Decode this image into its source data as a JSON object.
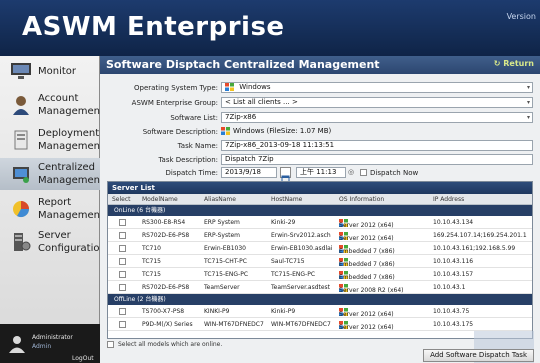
{
  "header": {
    "title": "ASWM Enterprise",
    "version": "Version"
  },
  "sidebar": {
    "items": [
      {
        "label": "Monitor",
        "icon": "monitor-icon"
      },
      {
        "label": "Account Management",
        "icon": "account-icon"
      },
      {
        "label": "Deployment Management",
        "icon": "deployment-icon"
      },
      {
        "label": "Centralized Management",
        "icon": "centralized-icon"
      },
      {
        "label": "Report Management",
        "icon": "report-icon"
      },
      {
        "label": "Server Configuration",
        "icon": "server-icon"
      }
    ],
    "user": {
      "name": "Administrator",
      "role": "Admin",
      "logout": "LogOut"
    }
  },
  "main": {
    "title": "Software Disptach Centralized Management",
    "return_label": "Return",
    "form": {
      "os_type_label": "Operating System Type:",
      "os_type_value": "Windows",
      "group_label": "ASWM Enterprise Group:",
      "group_value": "< List all clients ... >",
      "software_list_label": "Software List:",
      "software_list_value": "7Zip-x86",
      "software_desc_label": "Software Description:",
      "software_desc_value": "Windows (FileSize: 1.07 MB)",
      "task_name_label": "Task Name:",
      "task_name_value": "7Zip-x86_2013-09-18 11:13:51",
      "task_desc_label": "Task Description:",
      "task_desc_value": "Dispatch 7Zip",
      "dispatch_time_label": "Dispatch Time:",
      "dispatch_date": "2013/9/18",
      "dispatch_clock": "上午 11:13",
      "dispatch_now": "Dispatch Now"
    },
    "server_list": {
      "title": "Server List",
      "columns": [
        "Select",
        "ModelName",
        "AliasName",
        "HostName",
        "OS Information",
        "IP Address"
      ],
      "groups": [
        {
          "label": "OnLine (6 台機器)",
          "rows": [
            {
              "model": "RS300-E8-RS4",
              "alias": "ERP System",
              "host": "Kinki-29",
              "os": "Server 2012 (x64)",
              "ip": "10.10.43.134"
            },
            {
              "model": "RS702D-E6-PS8",
              "alias": "ERP-System",
              "host": "Erwin-Srv2012.asch",
              "os": "Server 2012 (x64)",
              "ip": "169.254.107.14;169.254.201.1"
            },
            {
              "model": "TC710",
              "alias": "Erwin-EB1030",
              "host": "Erwin-EB1030.asdlai",
              "os": "Embedded 7 (x86)",
              "ip": "10.10.43.161;192.168.5.99"
            },
            {
              "model": "TC715",
              "alias": "TC715-CHT-PC",
              "host": "Saul-TC715",
              "os": "Embedded 7 (x86)",
              "ip": "10.10.43.116"
            },
            {
              "model": "TC715",
              "alias": "TC715-ENG-PC",
              "host": "TC715-ENG-PC",
              "os": "Embedded 7 (x86)",
              "ip": "10.10.43.157"
            },
            {
              "model": "RS702D-E6-PS8",
              "alias": "TeamServer",
              "host": "TeamServer.asdtest",
              "os": "Server 2008 R2 (x64)",
              "ip": "10.10.43.1"
            }
          ]
        },
        {
          "label": "OffLine (2 台機器)",
          "rows": [
            {
              "model": "TS700-X7-PS8",
              "alias": "KINKI-P9",
              "host": "Kinki-P9",
              "os": "Server 2012 (x64)",
              "ip": "10.10.43.75"
            },
            {
              "model": "P9D-M(/X) Series",
              "alias": "WIN-MT67DFNEDC7",
              "host": "WIN-MT67DFNEDC7",
              "os": "Server 2012 (x64)",
              "ip": "10.10.43.175"
            }
          ]
        }
      ],
      "select_all": "Select all models which are online."
    },
    "add_button": "Add Software Dispatch Task"
  },
  "colors": {
    "header_bg": "#1d3b6e",
    "titlebar_bg": "#344f7a",
    "return_accent": "#d8e88a",
    "group_bg": "#273f66"
  }
}
